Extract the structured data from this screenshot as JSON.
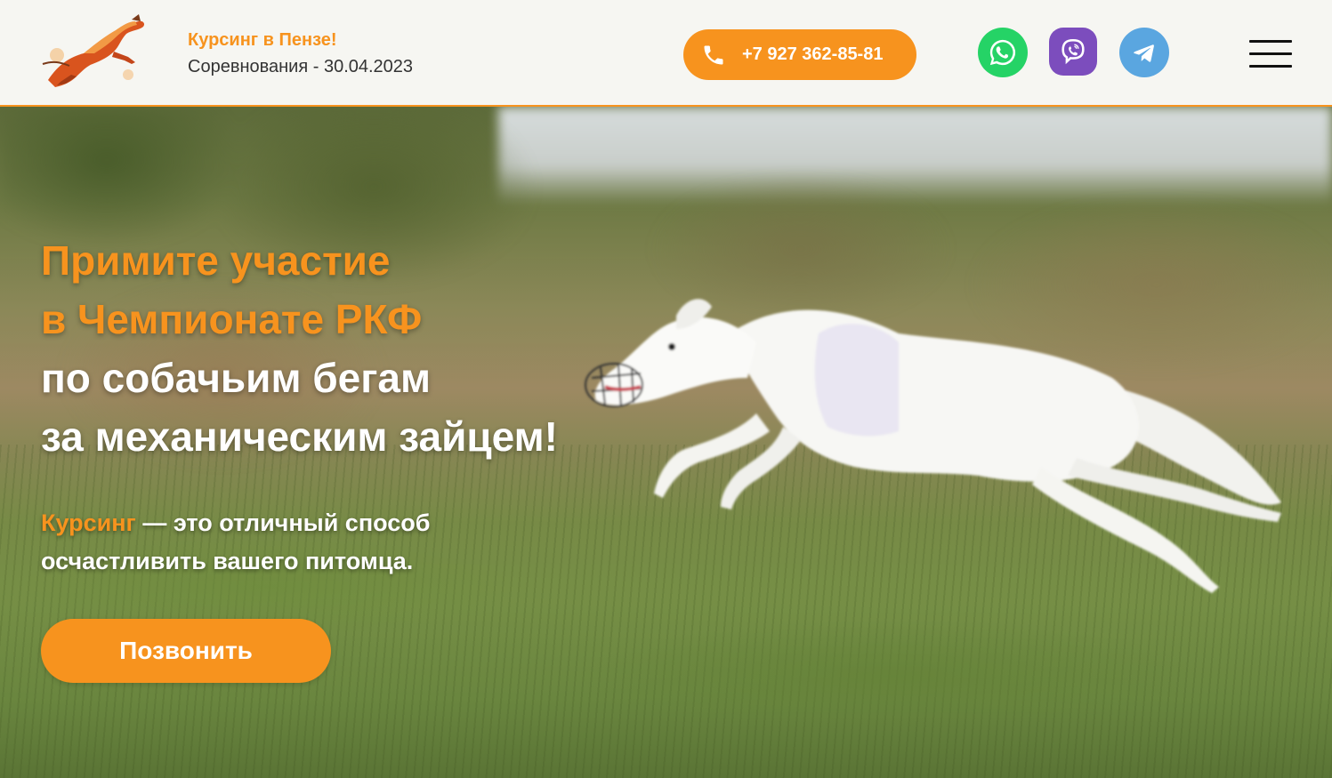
{
  "header": {
    "brand_title": "Курсинг в Пензе!",
    "brand_subtitle": "Соревнования - 30.04.2023",
    "phone": "+7 927 362-85-81",
    "socials": [
      {
        "name": "whatsapp-icon"
      },
      {
        "name": "viber-icon"
      },
      {
        "name": "telegram-icon"
      }
    ],
    "menu_icon": "hamburger-menu-icon"
  },
  "hero": {
    "title_line1": "Примите участие",
    "title_line2": "в Чемпионате РКФ",
    "title_line3": "по собачьим бегам",
    "title_line4": "за механическим зайцем!",
    "text_accent": "Курсинг",
    "text_rest1": " — это отличный способ",
    "text_rest2": "осчастливить вашего питомца.",
    "cta_label": "Позвонить"
  },
  "colors": {
    "accent": "#f7931e",
    "header_bg": "#f6f6f2",
    "text_dark": "#333333"
  }
}
